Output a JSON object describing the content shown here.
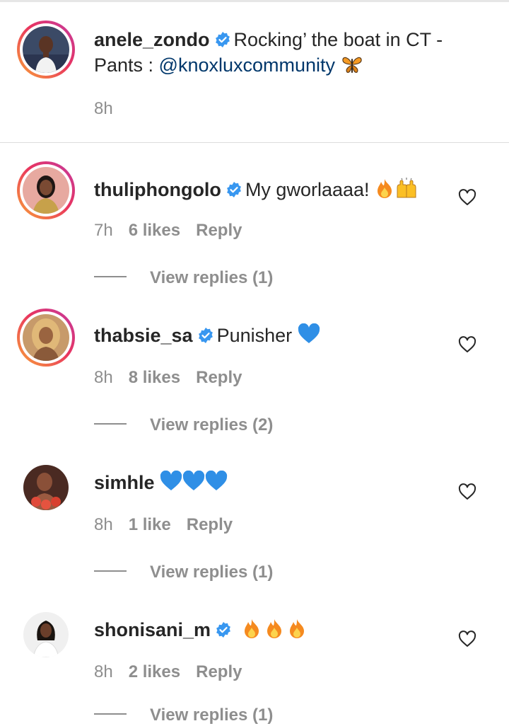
{
  "caption": {
    "username": "anele_zondo",
    "text": "Rocking’ the boat in CT -",
    "text2": "Pants : ",
    "mention": "@knoxluxcommunity",
    "time": "8h"
  },
  "comments": [
    {
      "username": "thuliphongolo",
      "verified": true,
      "text": "My gworlaaaa!",
      "emojis": [
        "fire",
        "raised-hands"
      ],
      "time": "7h",
      "likes": "6 likes",
      "reply": "Reply",
      "view_replies": "View replies (1)"
    },
    {
      "username": "thabsie_sa",
      "verified": true,
      "text": "Punisher",
      "emojis": [
        "blue-heart"
      ],
      "time": "8h",
      "likes": "8 likes",
      "reply": "Reply",
      "view_replies": "View replies (2)"
    },
    {
      "username": "simhle",
      "verified": false,
      "text": "",
      "emojis": [
        "blue-heart",
        "blue-heart",
        "blue-heart"
      ],
      "time": "8h",
      "likes": "1 like",
      "reply": "Reply",
      "view_replies": "View replies (1)"
    },
    {
      "username": "shonisani_m",
      "verified": true,
      "text": "",
      "emojis": [
        "fire",
        "fire",
        "fire"
      ],
      "time": "8h",
      "likes": "2 likes",
      "reply": "Reply",
      "view_replies": "View replies (1)"
    }
  ],
  "colors": {
    "verified_blue": "#3897f0",
    "muted_text": "#8e8e8e",
    "mention_link": "#00376b",
    "story_ring": "#e9345f"
  }
}
